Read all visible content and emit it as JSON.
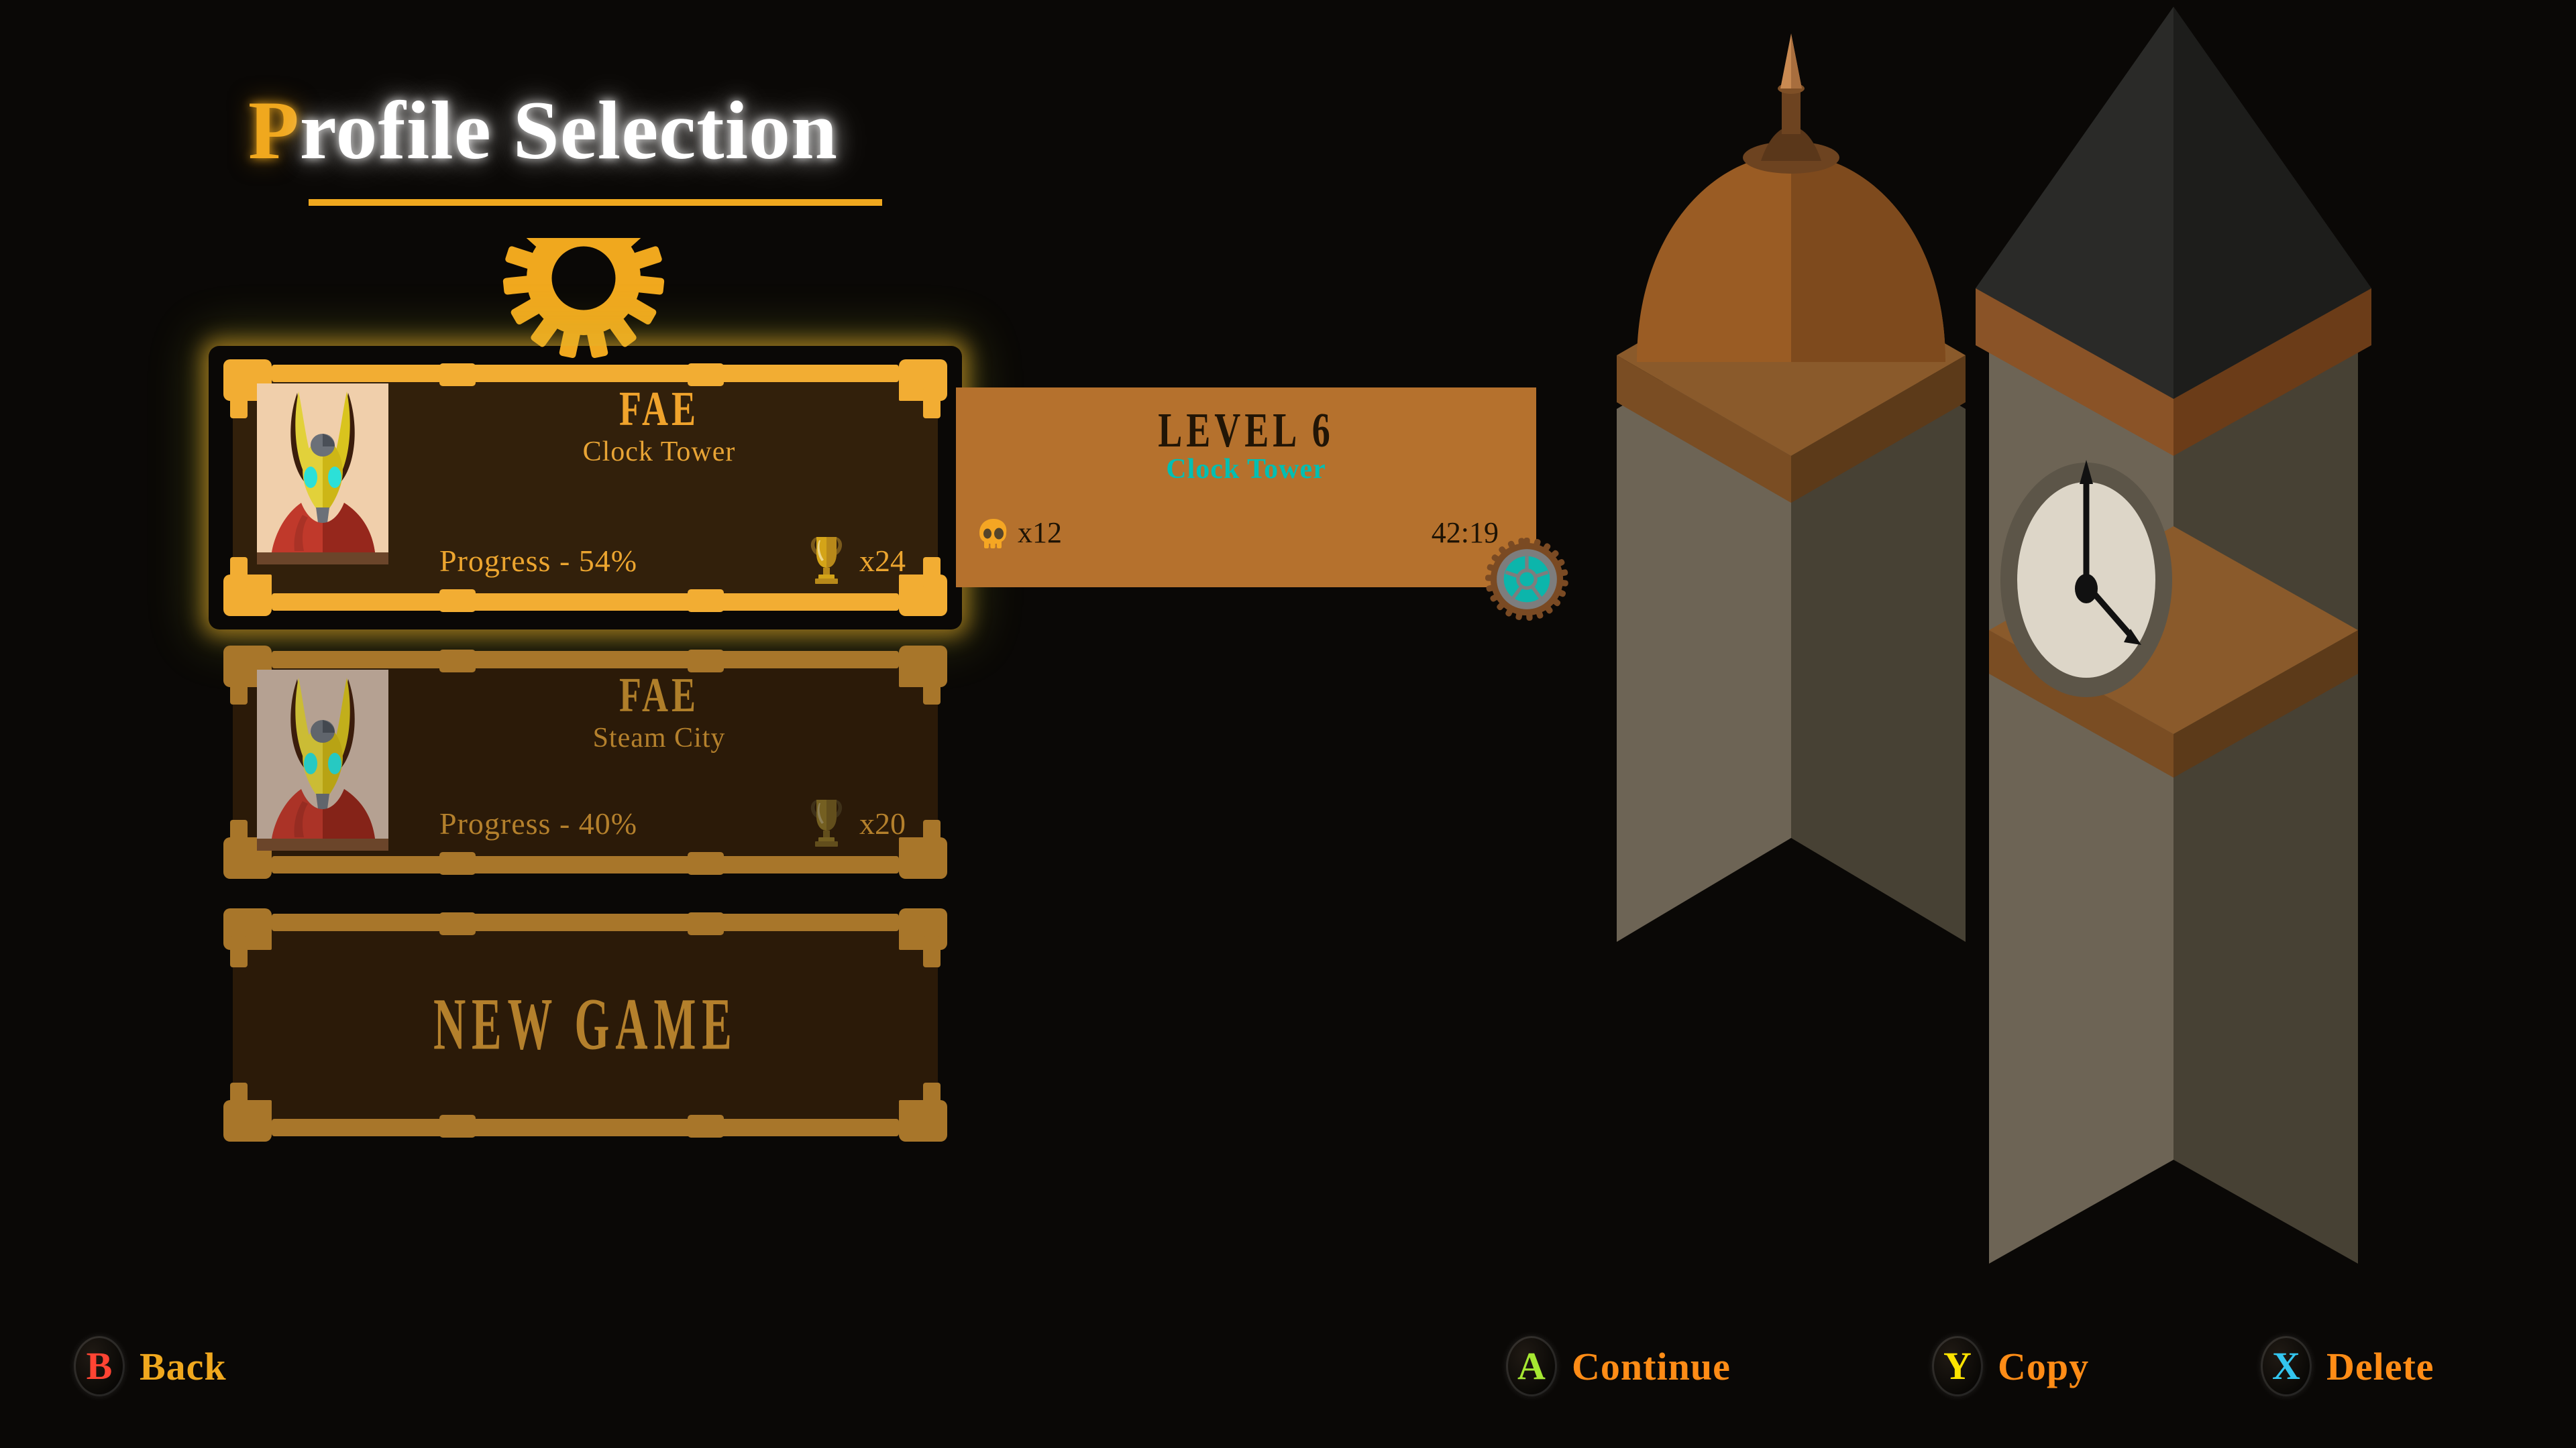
{
  "header": {
    "title_lead": "P",
    "title_rest": "rofile Selection",
    "gear_icon": "gear-icon",
    "rule_color": "#f0a81e"
  },
  "profiles": [
    {
      "name": "FAE",
      "area": "Clock Tower",
      "progress": "Progress - 54%",
      "trophy_icon": "trophy-icon",
      "trophies": "x24",
      "selected": true,
      "avatar_icon": "fae-avatar"
    },
    {
      "name": "FAE",
      "area": "Steam City",
      "progress": "Progress - 40%",
      "trophy_icon": "trophy-icon",
      "trophies": "x20",
      "selected": false,
      "avatar_icon": "fae-avatar"
    }
  ],
  "new_game": {
    "label": "NEW GAME"
  },
  "detail": {
    "level": "LEVEL 6",
    "area": "Clock Tower",
    "area_color": "#00bfb3",
    "skull_icon": "skull-icon",
    "deaths": "x12",
    "time": "42:19",
    "gear_icon": "gear-icon",
    "panel_color": "#b5712d"
  },
  "artwork": {
    "name": "clock-tower-illustration"
  },
  "buttons": [
    {
      "key": "B",
      "key_color": "#ff4433",
      "label": "Back",
      "label_color": "#f0a81e"
    },
    {
      "key": "A",
      "key_color": "#a6e832",
      "label": "Continue",
      "label_color": "#ff8c16"
    },
    {
      "key": "Y",
      "key_color": "#ffe400",
      "label": "Copy",
      "label_color": "#ff8c16"
    },
    {
      "key": "X",
      "key_color": "#33c6ef",
      "label": "Delete",
      "label_color": "#ff8c16"
    }
  ]
}
